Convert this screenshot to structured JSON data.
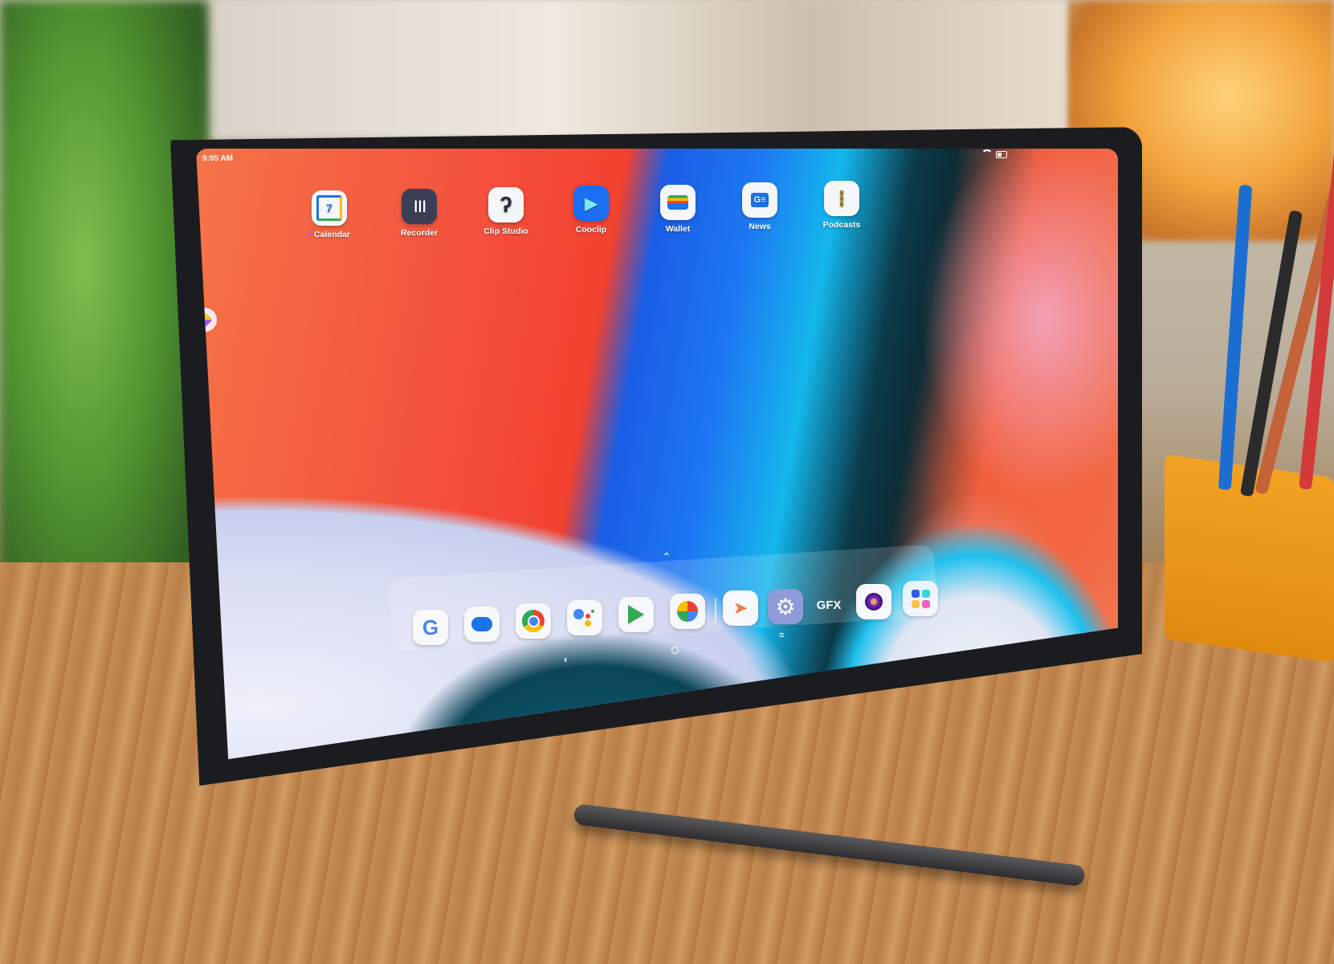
{
  "status_bar": {
    "time": "9:05 AM",
    "icons": [
      "wifi-icon",
      "battery-icon"
    ]
  },
  "home_apps": [
    {
      "label": "Calendar",
      "icon": "calendar-icon",
      "glyph": "7",
      "has_new_dot": true
    },
    {
      "label": "Recorder",
      "icon": "recorder-icon",
      "glyph": "┃┃┃"
    },
    {
      "label": "Clip Studio",
      "icon": "clip-studio-icon",
      "glyph": "ʔ"
    },
    {
      "label": "Cooclip",
      "icon": "cooclip-icon",
      "glyph": "▶"
    },
    {
      "label": "Wallet",
      "icon": "wallet-icon",
      "glyph": "▬"
    },
    {
      "label": "News",
      "icon": "news-icon",
      "glyph": "G≡"
    },
    {
      "label": "Podcasts",
      "icon": "podcasts-icon",
      "glyph": "┇"
    }
  ],
  "side_widget": {
    "icon": "side-toolbar-icon"
  },
  "dock": {
    "swipe_up_glyph": "⌃",
    "items": [
      {
        "name": "google",
        "icon": "google-icon",
        "glyph": "G",
        "color": "#4285f4"
      },
      {
        "name": "messages",
        "icon": "messages-icon",
        "glyph": "▬",
        "color": "#1a73e8"
      },
      {
        "name": "chrome",
        "icon": "chrome-icon",
        "glyph": "◉",
        "color": "#db4437"
      },
      {
        "name": "assistant",
        "icon": "assistant-icon",
        "glyph": "●",
        "color": "#4285f4"
      },
      {
        "name": "play-store",
        "icon": "play-store-icon",
        "glyph": "▶",
        "color": "#34a853"
      },
      {
        "name": "photos",
        "icon": "photos-icon",
        "glyph": "✿",
        "color": "#fbbc05"
      },
      {
        "name": "lenovo-freestyle",
        "icon": "freestyle-icon",
        "glyph": "➤",
        "color": "#f07a4a"
      },
      {
        "name": "settings",
        "icon": "settings-icon",
        "glyph": "⚙",
        "color": "#ffffff"
      },
      {
        "name": "gfx",
        "icon": "gfx-icon",
        "glyph": "GFX",
        "color": "#ffffff"
      },
      {
        "name": "camera",
        "icon": "camera-icon",
        "glyph": "◉",
        "color": "#5b1d9a"
      },
      {
        "name": "app-drawer",
        "icon": "app-drawer-icon",
        "glyph": "▣",
        "color": "#2f5bea"
      }
    ]
  },
  "nav_bar": {
    "back_glyph": "‹",
    "recents_glyph": "≡"
  }
}
